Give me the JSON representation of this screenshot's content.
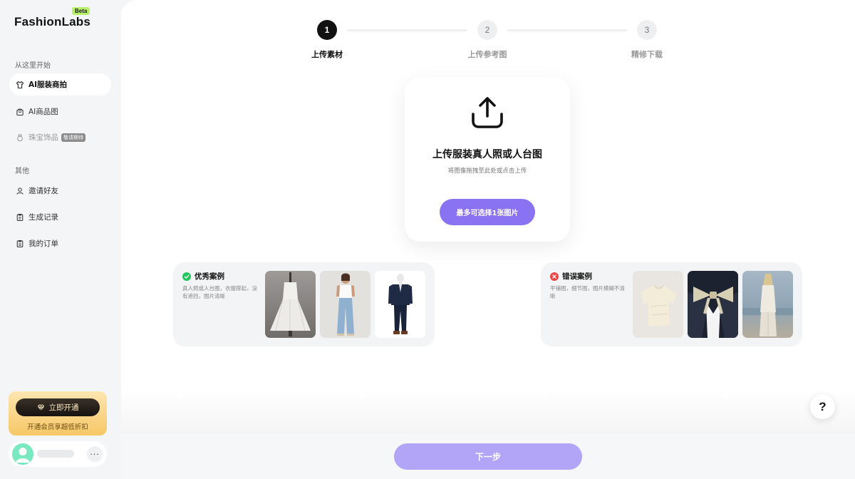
{
  "app": {
    "logo": "FashionLabs",
    "badge": "Beta"
  },
  "sidebar": {
    "section_start": "从这里开始",
    "section_other": "其他",
    "items": [
      {
        "label": "AI服装商拍",
        "icon": "shirt-icon",
        "active": true
      },
      {
        "label": "AI商品图",
        "icon": "bag-icon",
        "active": false
      },
      {
        "label": "珠宝饰品",
        "icon": "ring-icon",
        "active": false,
        "tag": "敬请期待"
      },
      {
        "label": "邀请好友",
        "icon": "user-icon",
        "active": false
      },
      {
        "label": "生成记录",
        "icon": "record-icon",
        "active": false
      },
      {
        "label": "我的订单",
        "icon": "order-icon",
        "active": false
      }
    ],
    "vip": {
      "button_label": "立即开通",
      "subtitle": "开通会员享超低折扣"
    },
    "user": {
      "more_label": "···"
    }
  },
  "steps": [
    {
      "number": "1",
      "label": "上传素材",
      "active": true
    },
    {
      "number": "2",
      "label": "上传参考图",
      "active": false
    },
    {
      "number": "3",
      "label": "精修下载",
      "active": false
    }
  ],
  "upload": {
    "title": "上传服装真人照或人台图",
    "subtitle": "将图像拖拽至此处或点击上传",
    "button_label": "最多可选择1张图片"
  },
  "examples": {
    "good": {
      "title": "优秀案例",
      "desc": "真人照或人台图，衣服撑起，没有遮挡，图片清晰",
      "thumbs": [
        "white-dress-mannequin",
        "jeans-model",
        "denim-jacket-mannequin"
      ],
      "color": "#22c55e"
    },
    "bad": {
      "title": "错误案例",
      "desc": "平铺图，细节图，图片模糊不清晰",
      "thumbs": [
        "flat-lay-shirt",
        "detail-bow-collar",
        "blurry-beach-model"
      ],
      "color": "#ef4444"
    }
  },
  "footer": {
    "next_label": "下一步"
  },
  "help": {
    "label": "?"
  },
  "colors": {
    "accent": "#8a73f2",
    "accent_disabled": "#b2a4f6",
    "vip_gold": "#f6c766"
  }
}
